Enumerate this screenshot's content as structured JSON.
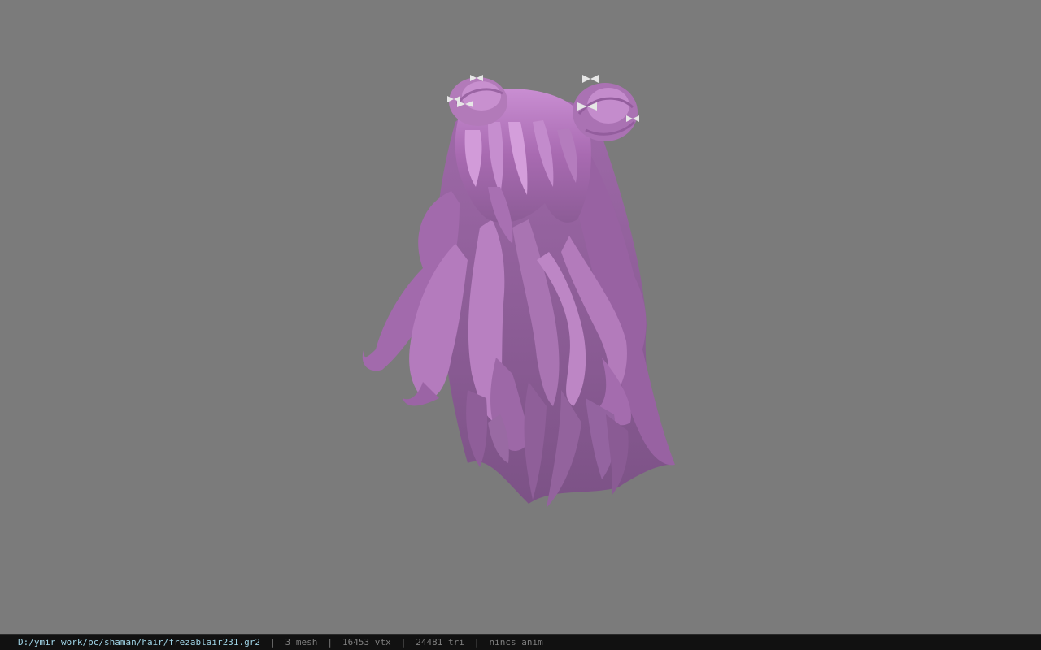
{
  "status_bar": {
    "file_path": "D:/ymir work/pc/shaman/hair/frezablair231.gr2",
    "separator": "|",
    "mesh": "3 mesh",
    "vertices": "16453 vtx",
    "triangles": "24481 tri",
    "anim": "nincs anim"
  },
  "colors": {
    "viewport_background": "#7b7b7b",
    "hair_light": "#c88bd0",
    "hair_mid": "#a869b2",
    "hair_dark": "#80528a",
    "bow": "#e8e8e8",
    "status_background": "#111111",
    "status_path": "#9fd4e6",
    "status_text": "#7f7f7f"
  }
}
